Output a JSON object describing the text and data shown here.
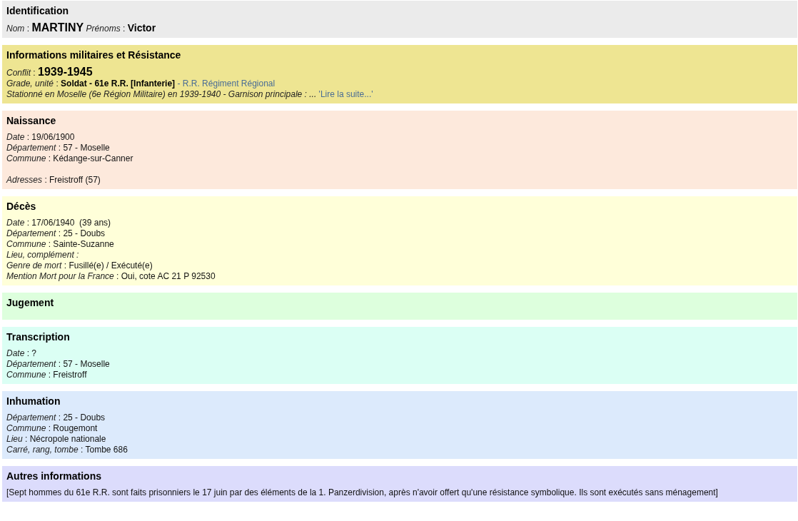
{
  "sections": [
    {
      "title": "Identification",
      "color": "#ebebeb",
      "lines": [
        [
          {
            "kind": "label",
            "text": "Nom"
          },
          {
            "kind": "plain",
            "text": ":"
          },
          {
            "kind": "strong",
            "text": "MARTINY"
          },
          {
            "kind": "label",
            "text": "Prénoms"
          },
          {
            "kind": "plain",
            "text": ":"
          },
          {
            "kind": "strong-small",
            "text": "Victor"
          }
        ]
      ]
    },
    {
      "title": "Informations militaires et Résistance",
      "color": "#eee592",
      "lines": [
        [
          {
            "kind": "label",
            "text": "Conflit"
          },
          {
            "kind": "plain",
            "text": ":"
          },
          {
            "kind": "strong",
            "text": "1939-1945"
          }
        ],
        [
          {
            "kind": "label",
            "text": "Grade, unité"
          },
          {
            "kind": "plain",
            "text": ":"
          },
          {
            "kind": "bold",
            "text": "Soldat - 61e R.R. [Infanterie]"
          },
          {
            "kind": "link",
            "text": "- R.R. Régiment Régional"
          }
        ],
        [
          {
            "kind": "label",
            "text": "Stationné en Moselle (6e Région Militaire) en 1939-1940 - Garnison principale : ..."
          },
          {
            "kind": "link",
            "text": "'Lire la suite...'"
          }
        ]
      ]
    },
    {
      "title": "Naissance",
      "color": "#fde9dc",
      "lines": [
        [
          {
            "kind": "label",
            "text": "Date"
          },
          {
            "kind": "plain",
            "text": ": 19/06/1900"
          }
        ],
        [
          {
            "kind": "label",
            "text": "Département"
          },
          {
            "kind": "plain",
            "text": ": 57 - Moselle"
          }
        ],
        [
          {
            "kind": "label",
            "text": "Commune"
          },
          {
            "kind": "plain",
            "text": ": Kédange-sur-Canner"
          }
        ],
        [
          {
            "kind": "gap"
          },
          {
            "kind": "label",
            "text": "Adresses"
          },
          {
            "kind": "plain",
            "text": ": Freistroff (57)"
          }
        ]
      ]
    },
    {
      "title": "Décès",
      "color": "#ffffd9",
      "lines": [
        [
          {
            "kind": "label",
            "text": "Date"
          },
          {
            "kind": "plain",
            "text": ": 17/06/1940  (39 ans)"
          }
        ],
        [
          {
            "kind": "label",
            "text": "Département"
          },
          {
            "kind": "plain",
            "text": ": 25 - Doubs"
          }
        ],
        [
          {
            "kind": "label",
            "text": "Commune"
          },
          {
            "kind": "plain",
            "text": ": Sainte-Suzanne"
          }
        ],
        [
          {
            "kind": "label",
            "text": "Lieu, complément :"
          }
        ],
        [
          {
            "kind": "label",
            "text": "Genre de mort"
          },
          {
            "kind": "plain",
            "text": ": Fusillé(e) / Exécuté(e)"
          }
        ],
        [
          {
            "kind": "label",
            "text": "Mention Mort pour la France"
          },
          {
            "kind": "plain",
            "text": ": Oui, cote AC 21 P 92530"
          }
        ]
      ]
    },
    {
      "title": "Jugement",
      "color": "#ddffdd"
    },
    {
      "title": "Transcription",
      "color": "#dbfff4",
      "lines": [
        [
          {
            "kind": "label",
            "text": "Date"
          },
          {
            "kind": "plain",
            "text": ": ?"
          }
        ],
        [
          {
            "kind": "label",
            "text": "Département"
          },
          {
            "kind": "plain",
            "text": ": 57 - Moselle"
          }
        ],
        [
          {
            "kind": "label",
            "text": "Commune"
          },
          {
            "kind": "plain",
            "text": ": Freistroff"
          }
        ]
      ]
    },
    {
      "title": "Inhumation",
      "color": "#dceafc",
      "lines": [
        [
          {
            "kind": "label",
            "text": "Département"
          },
          {
            "kind": "plain",
            "text": ": 25 - Doubs"
          }
        ],
        [
          {
            "kind": "label",
            "text": "Commune"
          },
          {
            "kind": "plain",
            "text": ": Rougemont"
          }
        ],
        [
          {
            "kind": "label",
            "text": "Lieu"
          },
          {
            "kind": "plain",
            "text": ": Nécropole nationale"
          }
        ],
        [
          {
            "kind": "label",
            "text": "Carré, rang, tombe"
          },
          {
            "kind": "plain",
            "text": ": Tombe 686"
          }
        ]
      ]
    },
    {
      "title": "Autres informations",
      "color": "#dcdcfc",
      "lines": [
        [
          {
            "kind": "plain",
            "text": "[Sept hommes du 61e R.R. sont faits prisonniers le 17 juin par des éléments de la 1. Panzerdivision, après n'avoir offert qu'une résistance symbolique. Ils sont exécutés sans ménagement]"
          }
        ]
      ]
    }
  ]
}
